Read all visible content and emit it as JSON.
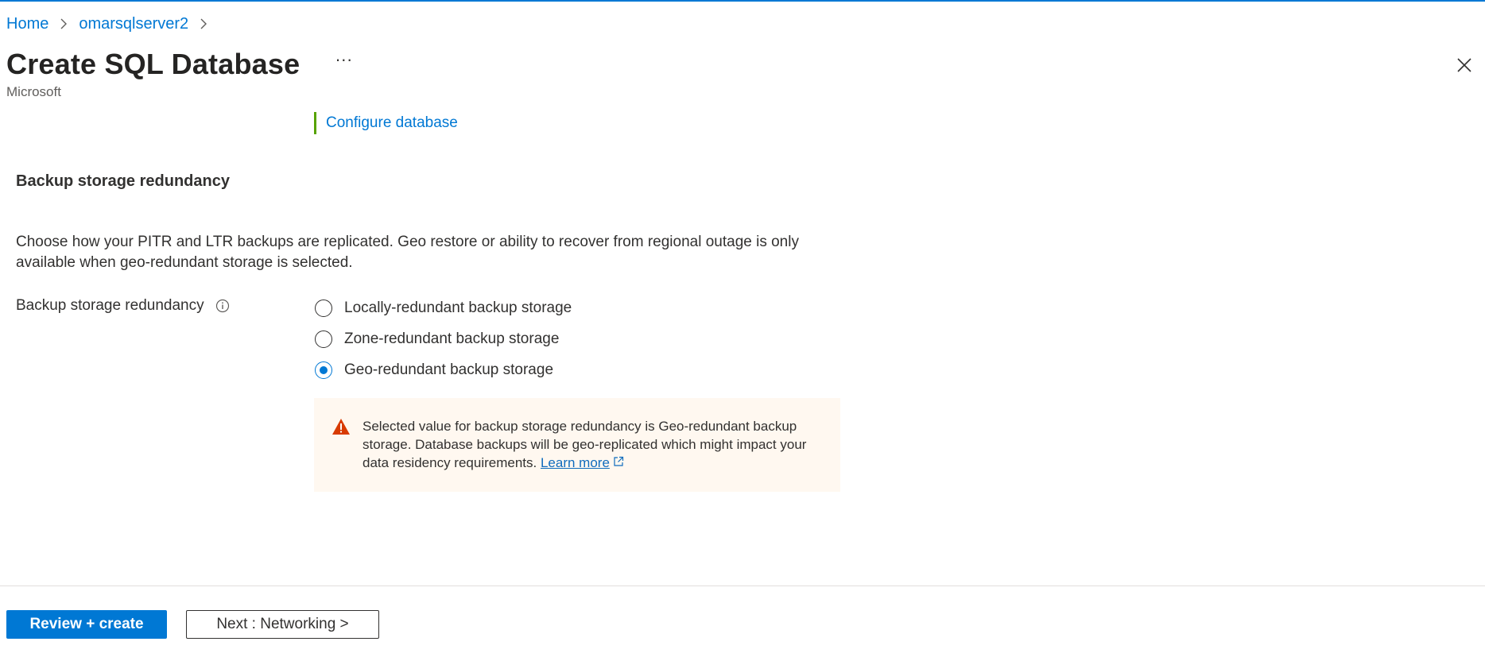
{
  "breadcrumb": {
    "items": [
      {
        "label": "Home"
      },
      {
        "label": "omarsqlserver2"
      }
    ]
  },
  "header": {
    "title": "Create SQL Database",
    "more_label": "···",
    "subtitle": "Microsoft"
  },
  "tab": {
    "label": "Configure database"
  },
  "section": {
    "title": "Backup storage redundancy",
    "description": "Choose how your PITR and LTR backups are replicated. Geo restore or ability to recover from regional outage is only available when geo-redundant storage is selected."
  },
  "field": {
    "label": "Backup storage redundancy",
    "options": [
      {
        "label": "Locally-redundant backup storage",
        "checked": false
      },
      {
        "label": "Zone-redundant backup storage",
        "checked": false
      },
      {
        "label": "Geo-redundant backup storage",
        "checked": true
      }
    ]
  },
  "warning": {
    "text": "Selected value for backup storage redundancy is Geo-redundant backup storage. Database backups will be geo-replicated which might impact your data residency requirements.",
    "link": "Learn more"
  },
  "footer": {
    "review_label": "Review + create",
    "next_label": "Next : Networking >"
  },
  "colors": {
    "accent": "#0078d4",
    "tab_indicator": "#57a300",
    "warning_bg": "#fff8f0",
    "warning_icon": "#d83b01"
  },
  "icons": [
    "chevron-right-icon",
    "more-icon",
    "close-icon",
    "info-icon",
    "warning-icon",
    "external-link-icon"
  ]
}
